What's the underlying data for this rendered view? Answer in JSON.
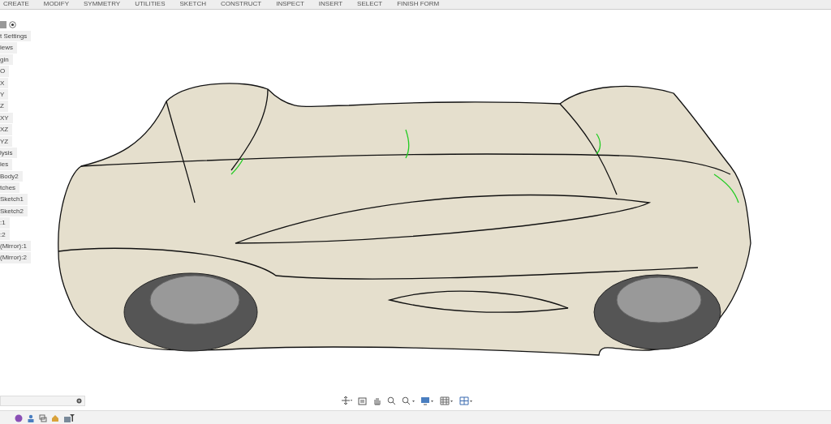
{
  "toolbar": {
    "menus": [
      {
        "label": "CREATE"
      },
      {
        "label": "MODIFY"
      },
      {
        "label": "SYMMETRY"
      },
      {
        "label": "UTILITIES"
      },
      {
        "label": "SKETCH"
      },
      {
        "label": "CONSTRUCT"
      },
      {
        "label": "INSPECT"
      },
      {
        "label": "INSERT"
      },
      {
        "label": "SELECT"
      },
      {
        "label": "FINISH FORM"
      }
    ]
  },
  "browser": {
    "items": [
      "t Settings",
      "iews",
      "gin",
      "O",
      "X",
      "Y",
      "Z",
      "XY",
      "XZ",
      "YZ",
      "lysis",
      "ies",
      "Body2",
      "tches",
      "Sketch1",
      "Sketch2",
      ":1",
      ":2",
      "(Mirror):1",
      "(Mirror):2"
    ]
  }
}
